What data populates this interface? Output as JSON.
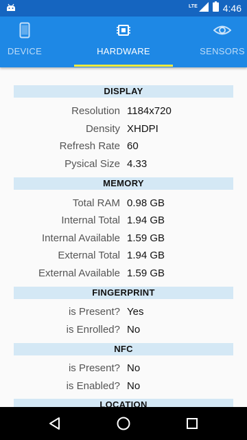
{
  "status_bar": {
    "network": "LTE",
    "time": "4:46"
  },
  "tabs": [
    {
      "label": "DEVICE",
      "icon": "phone-icon",
      "active": false
    },
    {
      "label": "HARDWARE",
      "icon": "chip-icon",
      "active": true
    },
    {
      "label": "SENSORS",
      "icon": "eye-icon",
      "active": false
    }
  ],
  "sections": {
    "display": {
      "title": "DISPLAY",
      "rows": [
        {
          "key": "Resolution",
          "value": "1184x720"
        },
        {
          "key": "Density",
          "value": "XHDPI"
        },
        {
          "key": "Refresh Rate",
          "value": "60"
        },
        {
          "key": "Pysical Size",
          "value": "4.33"
        }
      ]
    },
    "memory": {
      "title": "MEMORY",
      "rows": [
        {
          "key": "Total RAM",
          "value": "0.98 GB"
        },
        {
          "key": "Internal Total",
          "value": "1.94 GB"
        },
        {
          "key": "Internal Available",
          "value": "1.59 GB"
        },
        {
          "key": "External Total",
          "value": "1.94 GB"
        },
        {
          "key": "External Available",
          "value": "1.59 GB"
        }
      ]
    },
    "fingerprint": {
      "title": "FINGERPRINT",
      "rows": [
        {
          "key": "is Present?",
          "value": "Yes"
        },
        {
          "key": "is Enrolled?",
          "value": "No"
        }
      ]
    },
    "nfc": {
      "title": "NFC",
      "rows": [
        {
          "key": "is Present?",
          "value": "No"
        },
        {
          "key": "is Enabled?",
          "value": "No"
        }
      ]
    },
    "location": {
      "title": "LOCATION"
    }
  },
  "colors": {
    "status_bar": "#1565c0",
    "app_bar": "#1e88e5",
    "tab_indicator": "#ffeb3b",
    "section_header": "#d4e8f5"
  }
}
